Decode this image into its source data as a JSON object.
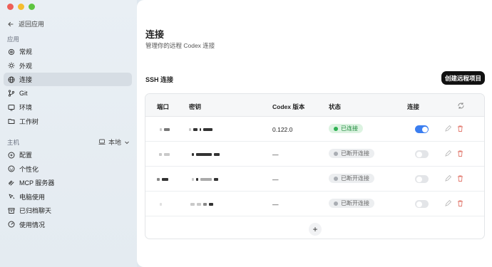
{
  "sidebar": {
    "back_label": "返回应用",
    "section_app": "应用",
    "app_items": [
      {
        "label": "常规",
        "icon": "gear-icon"
      },
      {
        "label": "外观",
        "icon": "sun-icon"
      },
      {
        "label": "连接",
        "icon": "globe-icon"
      },
      {
        "label": "Git",
        "icon": "git-branch-icon"
      },
      {
        "label": "环境",
        "icon": "monitor-icon"
      },
      {
        "label": "工作树",
        "icon": "folder-tree-icon"
      }
    ],
    "section_host": "主机",
    "host_value": "本地",
    "host_items": [
      {
        "label": "配置",
        "icon": "config-icon"
      },
      {
        "label": "个性化",
        "icon": "face-icon"
      },
      {
        "label": "MCP 服务器",
        "icon": "mcp-icon"
      },
      {
        "label": "电脑使用",
        "icon": "cursor-icon"
      },
      {
        "label": "已归档聊天",
        "icon": "archive-icon"
      },
      {
        "label": "使用情况",
        "icon": "gauge-icon"
      }
    ]
  },
  "main": {
    "title": "连接",
    "subtitle": "管理你的远程 Codex 连接",
    "ssh_heading": "SSH 连接",
    "create_button": "创建远程项目",
    "table": {
      "headers": {
        "port": "端口",
        "key": "密钥",
        "version": "Codex 版本",
        "status": "状态",
        "connect": "连接"
      },
      "rows": [
        {
          "version": "0.122.0",
          "status": "已连接",
          "connected": true
        },
        {
          "version": "—",
          "status": "已断开连接",
          "connected": false
        },
        {
          "version": "—",
          "status": "已断开连接",
          "connected": false
        },
        {
          "version": "—",
          "status": "已断开连接",
          "connected": false
        }
      ]
    },
    "add_button": "+"
  },
  "colors": {
    "accent": "#3b7ef0",
    "connected": "#2fb152",
    "delete": "#e2786d"
  }
}
